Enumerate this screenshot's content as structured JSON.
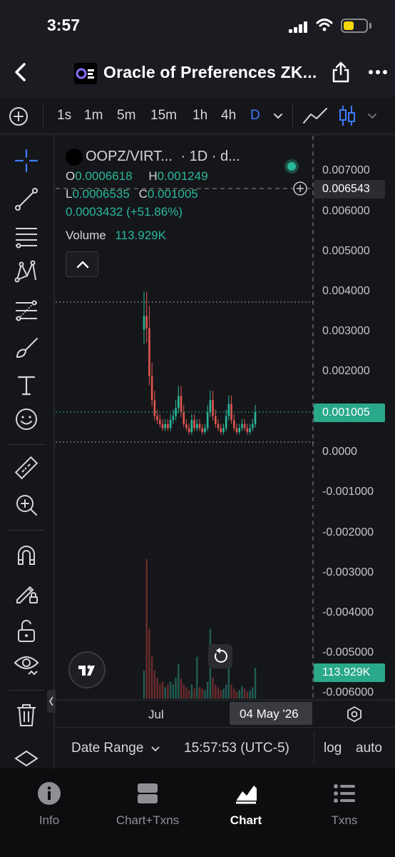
{
  "status_bar": {
    "time": "3:57",
    "battery_color": "#f4d60c"
  },
  "header": {
    "title": "Oracle of Preferences ZK...",
    "back_icon": "chevron-left-icon",
    "share_icon": "share-icon",
    "more_icon": "more-horizontal-icon"
  },
  "timeframes": [
    "1s",
    "1m",
    "5m",
    "15m",
    "1h",
    "4h",
    "D"
  ],
  "active_timeframe": "D",
  "drawing_tools": [
    "crosshair-icon",
    "trend-line-icon",
    "horizontal-lines-icon",
    "pattern-icon",
    "fib-icon",
    "brush-icon",
    "text-icon",
    "emoji-icon",
    "ruler-icon",
    "zoom-in-icon",
    "magnet-icon",
    "lock-drawing-icon",
    "unlock-icon",
    "eye-icon",
    "trash-icon",
    "layers-icon"
  ],
  "legend": {
    "symbol": "OOPZ/VIRT...",
    "interval": "· 1D · d...",
    "o_label": "O",
    "o_value": "0.0006618",
    "h_label": "H",
    "h_value": "0.001249",
    "l_label": "L",
    "l_value": "0.0006535",
    "c_label": "C",
    "c_value": "0.001005",
    "change": "0.0003432 (+51.86%)",
    "volume_label": "Volume",
    "volume_value": "113.929K"
  },
  "price_axis": {
    "ticks": [
      "0.007000",
      "0.006000",
      "0.005000",
      "0.004000",
      "0.003000",
      "0.002000",
      "0.0000",
      "-0.001000",
      "-0.002000",
      "-0.003000",
      "-0.004000",
      "-0.005000",
      "-0.006000"
    ],
    "cursor_price": "0.006543",
    "last_price": "0.001005",
    "volume_label": "113.929K"
  },
  "time_axis": {
    "month_label": "Jul",
    "cursor_date": "04 May '26"
  },
  "bottom_controls": {
    "date_range": "Date Range",
    "time": "15:57:53 (UTC-5)",
    "log": "log",
    "auto": "auto"
  },
  "tabs": [
    {
      "label": "Info",
      "icon": "info-icon"
    },
    {
      "label": "Chart+Txns",
      "icon": "split-view-icon"
    },
    {
      "label": "Chart",
      "icon": "chart-icon"
    },
    {
      "label": "Txns",
      "icon": "list-icon"
    }
  ],
  "active_tab": "Chart",
  "colors": {
    "up": "#2ab89a",
    "down": "#e0564f",
    "accent": "#3d7bff"
  },
  "chart_data": {
    "type": "candlestick",
    "pair": "OOPZ/VIRT",
    "interval": "1D",
    "close_series": [
      0.0034,
      0.0031,
      0.0019,
      0.0013,
      0.0009,
      0.0008,
      0.0007,
      0.0006,
      0.0007,
      0.0006,
      0.0008,
      0.0009,
      0.0011,
      0.0014,
      0.001,
      0.0007,
      0.0006,
      0.0005,
      0.0008,
      0.0006,
      0.0007,
      0.0006,
      0.0005,
      0.0006,
      0.001,
      0.0013,
      0.0009,
      0.0007,
      0.0006,
      0.0005,
      0.0006,
      0.0009,
      0.0012,
      0.0008,
      0.0006,
      0.0005,
      0.0006,
      0.0007,
      0.0006,
      0.0005,
      0.0006,
      0.0007,
      0.001
    ],
    "volume_series": [
      0.2,
      1.0,
      0.5,
      0.3,
      0.2,
      0.15,
      0.1,
      0.12,
      0.08,
      0.1,
      0.12,
      0.1,
      0.15,
      0.25,
      0.14,
      0.1,
      0.08,
      0.06,
      0.1,
      0.07,
      0.3,
      0.08,
      0.07,
      0.06,
      0.12,
      0.5,
      0.15,
      0.1,
      0.08,
      0.06,
      0.07,
      0.1,
      0.35,
      0.1,
      0.07,
      0.05,
      0.06,
      0.09,
      0.07,
      0.05,
      0.06,
      0.08,
      0.22
    ],
    "ylim": [
      -0.006,
      0.007
    ]
  }
}
